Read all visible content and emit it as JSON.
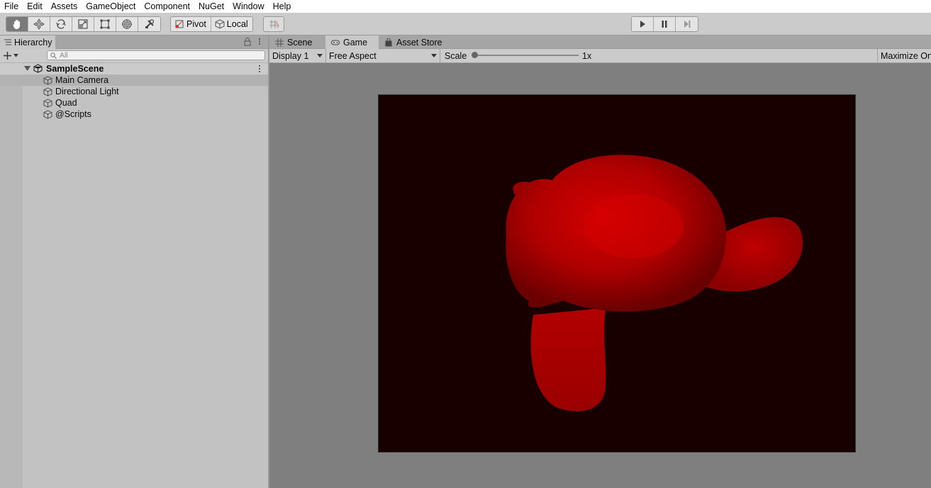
{
  "menu": [
    "File",
    "Edit",
    "Assets",
    "GameObject",
    "Component",
    "NuGet",
    "Window",
    "Help"
  ],
  "toolbar": {
    "tools": [
      "hand-tool",
      "move-tool",
      "rotate-tool",
      "scale-tool",
      "rect-tool",
      "transform-tool",
      "custom-editor-tool"
    ],
    "pivot_label": "Pivot",
    "local_label": "Local",
    "play_controls": [
      "play",
      "pause",
      "step"
    ]
  },
  "hierarchy": {
    "tab_label": "Hierarchy",
    "search_placeholder": "All",
    "scene_name": "SampleScene",
    "items": [
      "Main Camera",
      "Directional Light",
      "Quad",
      "@Scripts"
    ]
  },
  "game_panel": {
    "tabs": [
      "Scene",
      "Game",
      "Asset Store"
    ],
    "display": "Display 1",
    "aspect": "Free Aspect",
    "scale_label": "Scale",
    "scale_value": "1x",
    "maximize_label": "Maximize On"
  },
  "colors": {
    "viewport_bg": "#190000",
    "model_color": "#cc0000"
  }
}
